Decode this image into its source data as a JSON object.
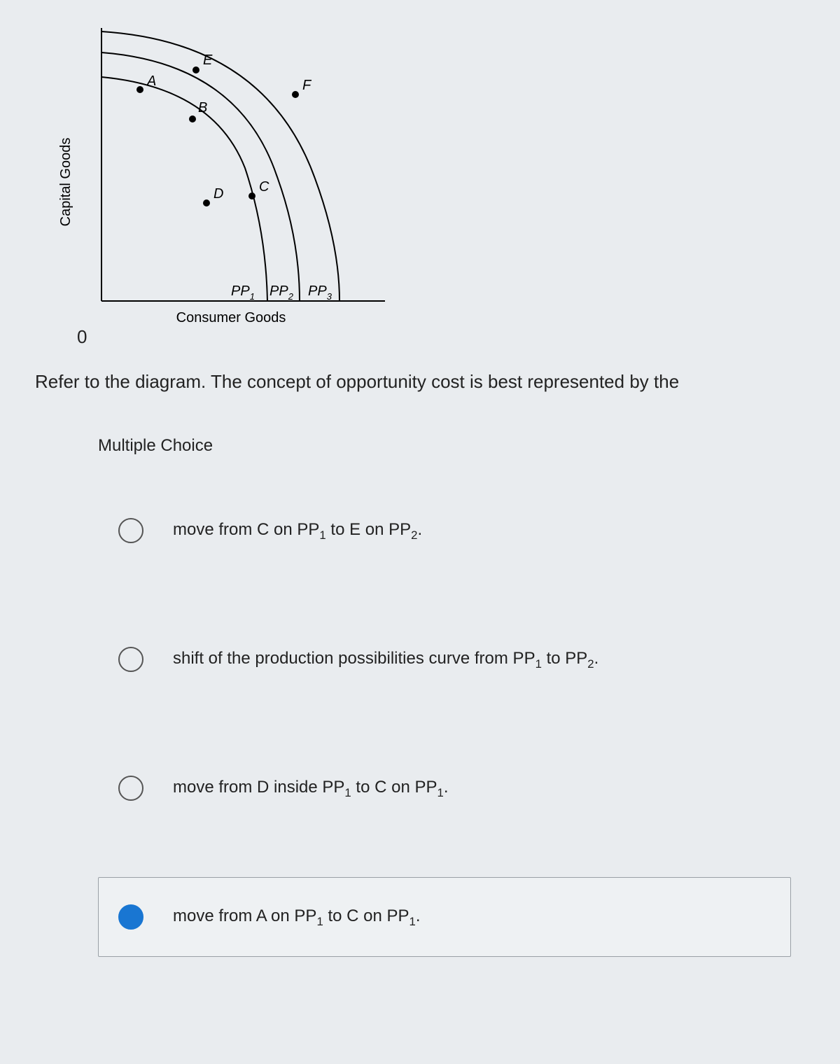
{
  "diagram": {
    "y_axis_label": "Capital Goods",
    "x_axis_label": "Consumer Goods",
    "origin_label": "0",
    "points": {
      "A": "A",
      "B": "B",
      "C": "C",
      "D": "D",
      "E": "E",
      "F": "F"
    },
    "curves": {
      "pp1_base": "PP",
      "pp1_sub": "1",
      "pp2_base": "PP",
      "pp2_sub": "2",
      "pp3_base": "PP",
      "pp3_sub": "3"
    }
  },
  "question": "Refer to the diagram. The concept of opportunity cost is best represented by the",
  "mc_heading": "Multiple Choice",
  "options": [
    {
      "pre": "move from C on PP",
      "sub1": "1",
      "mid": " to E on PP",
      "sub2": "2",
      "post": ".",
      "selected": false
    },
    {
      "pre": "shift of the production possibilities curve from PP",
      "sub1": "1",
      "mid": " to PP",
      "sub2": "2",
      "post": ".",
      "selected": false
    },
    {
      "pre": "move from D inside PP",
      "sub1": "1",
      "mid": " to C on PP",
      "sub2": "1",
      "post": ".",
      "selected": false
    },
    {
      "pre": "move from A on PP",
      "sub1": "1",
      "mid": " to C on PP",
      "sub2": "1",
      "post": ".",
      "selected": true
    }
  ]
}
